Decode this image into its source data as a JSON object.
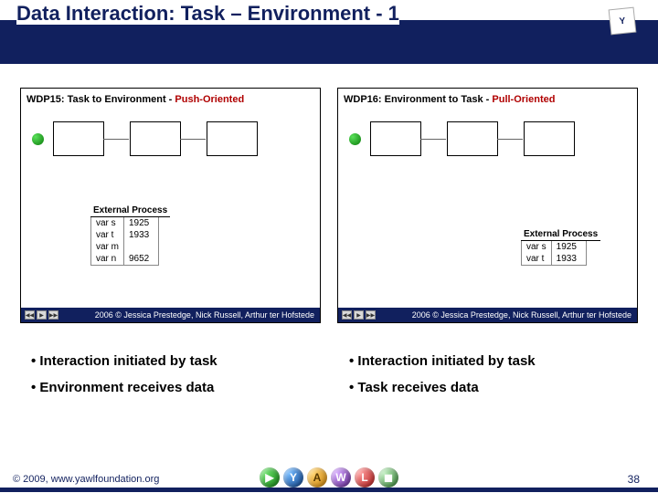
{
  "title": "Data Interaction: Task – Environment - 1",
  "logo_text": "Y",
  "panels": {
    "left": {
      "heading_prefix": "WDP15: ",
      "heading_main": "Task to Environment - ",
      "heading_accent": "Push-Oriented",
      "ext_label": "External Process",
      "vars": [
        {
          "name": "var s",
          "val": "1925"
        },
        {
          "name": "var t",
          "val": "1933"
        },
        {
          "name": "var m",
          "val": ""
        },
        {
          "name": "var n",
          "val": "9652"
        }
      ],
      "credit": "2006 © Jessica Prestedge, Nick Russell, Arthur ter Hofstede"
    },
    "right": {
      "heading_prefix": "WDP16: ",
      "heading_main": "Environment to Task - ",
      "heading_accent": "Pull-Oriented",
      "ext_label": "External Process",
      "vars": [
        {
          "name": "var s",
          "val": "1925"
        },
        {
          "name": "var t",
          "val": "1933"
        }
      ],
      "credit": "2006 © Jessica Prestedge, Nick Russell, Arthur ter Hofstede"
    }
  },
  "bullets": {
    "left": [
      "• Interaction initiated by task",
      "• Environment receives data"
    ],
    "right": [
      "• Interaction initiated by task",
      "• Task receives data"
    ]
  },
  "footer": {
    "copyright": "© 2009, www.yawlfoundation.org",
    "page": "38",
    "logo_letters": [
      "▶",
      "Y",
      "A",
      "W",
      "L",
      "◼"
    ]
  },
  "controls": {
    "rw": "◀◀",
    "play": "▶",
    "ff": "▶▶"
  }
}
